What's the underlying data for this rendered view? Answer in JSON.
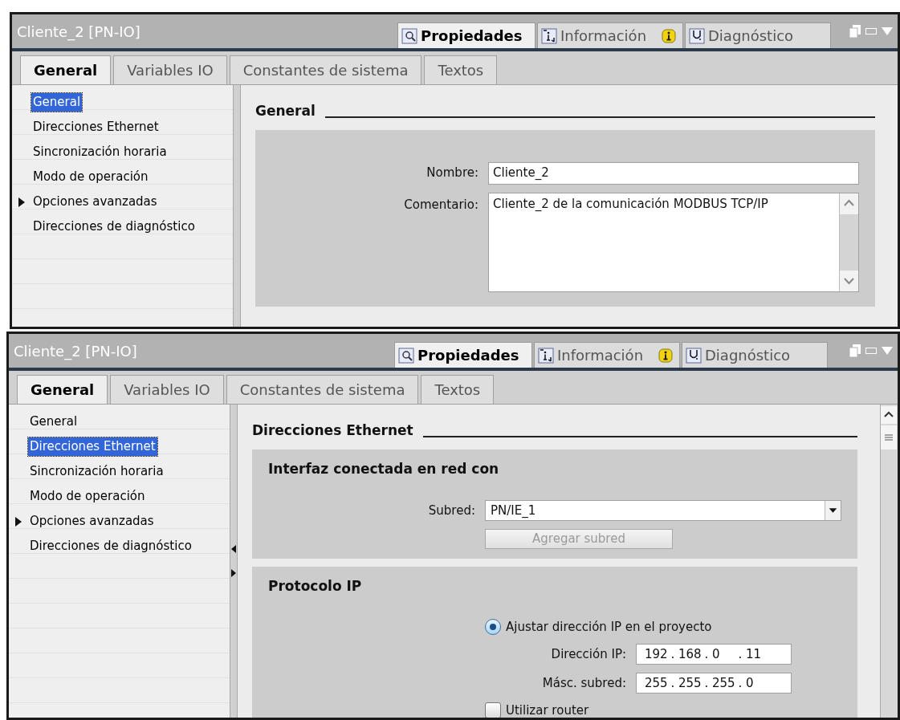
{
  "panels": [
    {
      "title": "Cliente_2 [PN-IO]",
      "view_tabs": [
        {
          "label": "Propiedades",
          "selected": true,
          "info_badge": false
        },
        {
          "label": "Información",
          "selected": false,
          "info_badge": true
        },
        {
          "label": "Diagnóstico",
          "selected": false,
          "info_badge": false
        }
      ],
      "tabs": [
        {
          "label": "General",
          "selected": true
        },
        {
          "label": "Variables IO",
          "selected": false
        },
        {
          "label": "Constantes de sistema",
          "selected": false
        },
        {
          "label": "Textos",
          "selected": false
        }
      ],
      "nav": [
        {
          "label": "General",
          "selected": true,
          "expandable": false
        },
        {
          "label": "Direcciones Ethernet",
          "selected": false,
          "expandable": false
        },
        {
          "label": "Sincronización horaria",
          "selected": false,
          "expandable": false
        },
        {
          "label": "Modo de operación",
          "selected": false,
          "expandable": false
        },
        {
          "label": "Opciones avanzadas",
          "selected": false,
          "expandable": true
        },
        {
          "label": "Direcciones de diagnóstico",
          "selected": false,
          "expandable": false
        }
      ],
      "content_scrollbar": false,
      "heading": "General",
      "groups": [
        {
          "rows": [
            {
              "kind": "text",
              "label": "Nombre:",
              "value": "Cliente_2"
            },
            {
              "kind": "textarea",
              "label": "Comentario:",
              "value": "Cliente_2 de la comunicación MODBUS TCP/IP"
            }
          ]
        }
      ]
    },
    {
      "title": "Cliente_2 [PN-IO]",
      "view_tabs": [
        {
          "label": "Propiedades",
          "selected": true,
          "info_badge": false
        },
        {
          "label": "Información",
          "selected": false,
          "info_badge": true
        },
        {
          "label": "Diagnóstico",
          "selected": false,
          "info_badge": false
        }
      ],
      "tabs": [
        {
          "label": "General",
          "selected": true
        },
        {
          "label": "Variables IO",
          "selected": false
        },
        {
          "label": "Constantes de sistema",
          "selected": false
        },
        {
          "label": "Textos",
          "selected": false
        }
      ],
      "nav": [
        {
          "label": "General",
          "selected": false,
          "expandable": false
        },
        {
          "label": "Direcciones Ethernet",
          "selected": true,
          "expandable": false
        },
        {
          "label": "Sincronización horaria",
          "selected": false,
          "expandable": false
        },
        {
          "label": "Modo de operación",
          "selected": false,
          "expandable": false
        },
        {
          "label": "Opciones avanzadas",
          "selected": false,
          "expandable": true
        },
        {
          "label": "Direcciones de diagnóstico",
          "selected": false,
          "expandable": false
        }
      ],
      "content_scrollbar": true,
      "heading": "Direcciones Ethernet",
      "groups": [
        {
          "title": "Interfaz conectada en red con",
          "rows": [
            {
              "kind": "select",
              "label": "Subred:",
              "value": "PN/IE_1"
            },
            {
              "kind": "button",
              "label": "Agregar subred",
              "disabled": true
            }
          ]
        },
        {
          "title": "Protocolo IP",
          "rows": [
            {
              "kind": "radio",
              "label": "Ajustar dirección IP en el proyecto",
              "selected": true
            },
            {
              "kind": "ip",
              "label": "Dirección IP:",
              "octets": [
                "192",
                "168",
                "0",
                "11"
              ],
              "separator": "."
            },
            {
              "kind": "ip",
              "label": "Másc. subred:",
              "octets": [
                "255",
                "255",
                "255",
                "0"
              ],
              "separator": "."
            },
            {
              "kind": "checkbox",
              "label": "Utilizar router",
              "checked": false
            }
          ]
        }
      ]
    }
  ]
}
